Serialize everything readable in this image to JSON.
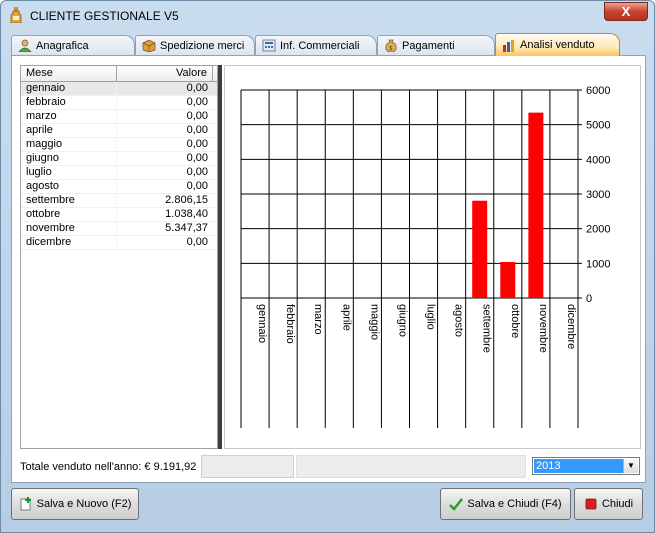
{
  "window": {
    "title": "CLIENTE GESTIONALE V5",
    "close_label": "X"
  },
  "tabs": [
    {
      "label": "Anagrafica",
      "icon": "user-icon"
    },
    {
      "label": "Spedizione merci",
      "icon": "box-icon"
    },
    {
      "label": "Inf. Commerciali",
      "icon": "calculator-icon"
    },
    {
      "label": "Pagamenti",
      "icon": "money-bag-icon"
    },
    {
      "label": "Analisi venduto",
      "icon": "bar-chart-icon",
      "active": true
    }
  ],
  "grid": {
    "headers": {
      "mese": "Mese",
      "valore": "Valore"
    },
    "rows": [
      {
        "mese": "gennaio",
        "valore": "0,00"
      },
      {
        "mese": "febbraio",
        "valore": "0,00"
      },
      {
        "mese": "marzo",
        "valore": "0,00"
      },
      {
        "mese": "aprile",
        "valore": "0,00"
      },
      {
        "mese": "maggio",
        "valore": "0,00"
      },
      {
        "mese": "giugno",
        "valore": "0,00"
      },
      {
        "mese": "luglio",
        "valore": "0,00"
      },
      {
        "mese": "agosto",
        "valore": "0,00"
      },
      {
        "mese": "settembre",
        "valore": "2.806,15"
      },
      {
        "mese": "ottobre",
        "valore": "1.038,40"
      },
      {
        "mese": "novembre",
        "valore": "5.347,37"
      },
      {
        "mese": "dicembre",
        "valore": "0,00"
      }
    ]
  },
  "chart_data": {
    "type": "bar",
    "categories": [
      "gennaio",
      "febbraio",
      "marzo",
      "aprile",
      "maggio",
      "giugno",
      "luglio",
      "agosto",
      "settembre",
      "ottobre",
      "novembre",
      "dicembre"
    ],
    "values": [
      0,
      0,
      0,
      0,
      0,
      0,
      0,
      0,
      2806.15,
      1038.4,
      5347.37,
      0
    ],
    "ylim": [
      0,
      6000
    ],
    "yticks": [
      0,
      1000,
      2000,
      3000,
      4000,
      5000,
      6000
    ],
    "y_axis_side": "right",
    "grid": true,
    "bar_color": "#ff0000",
    "title": "",
    "xlabel": "",
    "ylabel": ""
  },
  "status": {
    "total_label": "Totale venduto nell'anno: € 9.191,92"
  },
  "year_select": {
    "value": "2013"
  },
  "buttons": {
    "save_new": "Salva e Nuovo (F2)",
    "save_close": "Salva e Chiudi (F4)",
    "close": "Chiudi"
  }
}
